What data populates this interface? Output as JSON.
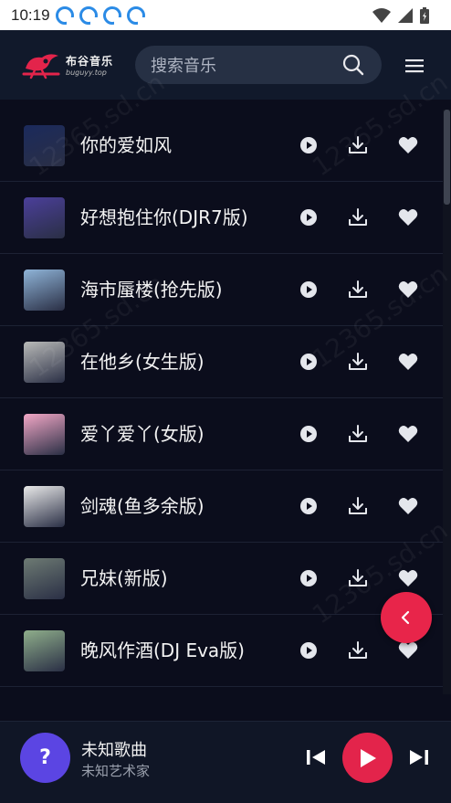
{
  "status_bar": {
    "time": "10:19"
  },
  "header": {
    "logo_name": "布谷音乐",
    "logo_url": "buguyy.top",
    "search_placeholder": "搜索音乐"
  },
  "songs": [
    {
      "title": "你的爱如风",
      "cover_color": "#1b2a5c"
    },
    {
      "title": "好想抱住你(DJR7版)",
      "cover_color": "#4b3f9a"
    },
    {
      "title": "海市蜃楼(抢先版)",
      "cover_color": "#8fb4d8"
    },
    {
      "title": "在他乡(女生版)",
      "cover_color": "#b9bab8"
    },
    {
      "title": "爱丫爱丫(女版)",
      "cover_color": "#f2a7c6"
    },
    {
      "title": "剑魂(鱼多余版)",
      "cover_color": "#e9e9e9"
    },
    {
      "title": "兄妹(新版)",
      "cover_color": "#6d7a73"
    },
    {
      "title": "晚风作酒(DJ Eva版)",
      "cover_color": "#8fae8b"
    }
  ],
  "player": {
    "cover_label": "?",
    "title": "未知歌曲",
    "artist": "未知艺术家"
  },
  "watermark": "12365.sd.cn",
  "colors": {
    "accent": "#e3244b",
    "background": "#0b0d1c",
    "header": "#11192b"
  }
}
